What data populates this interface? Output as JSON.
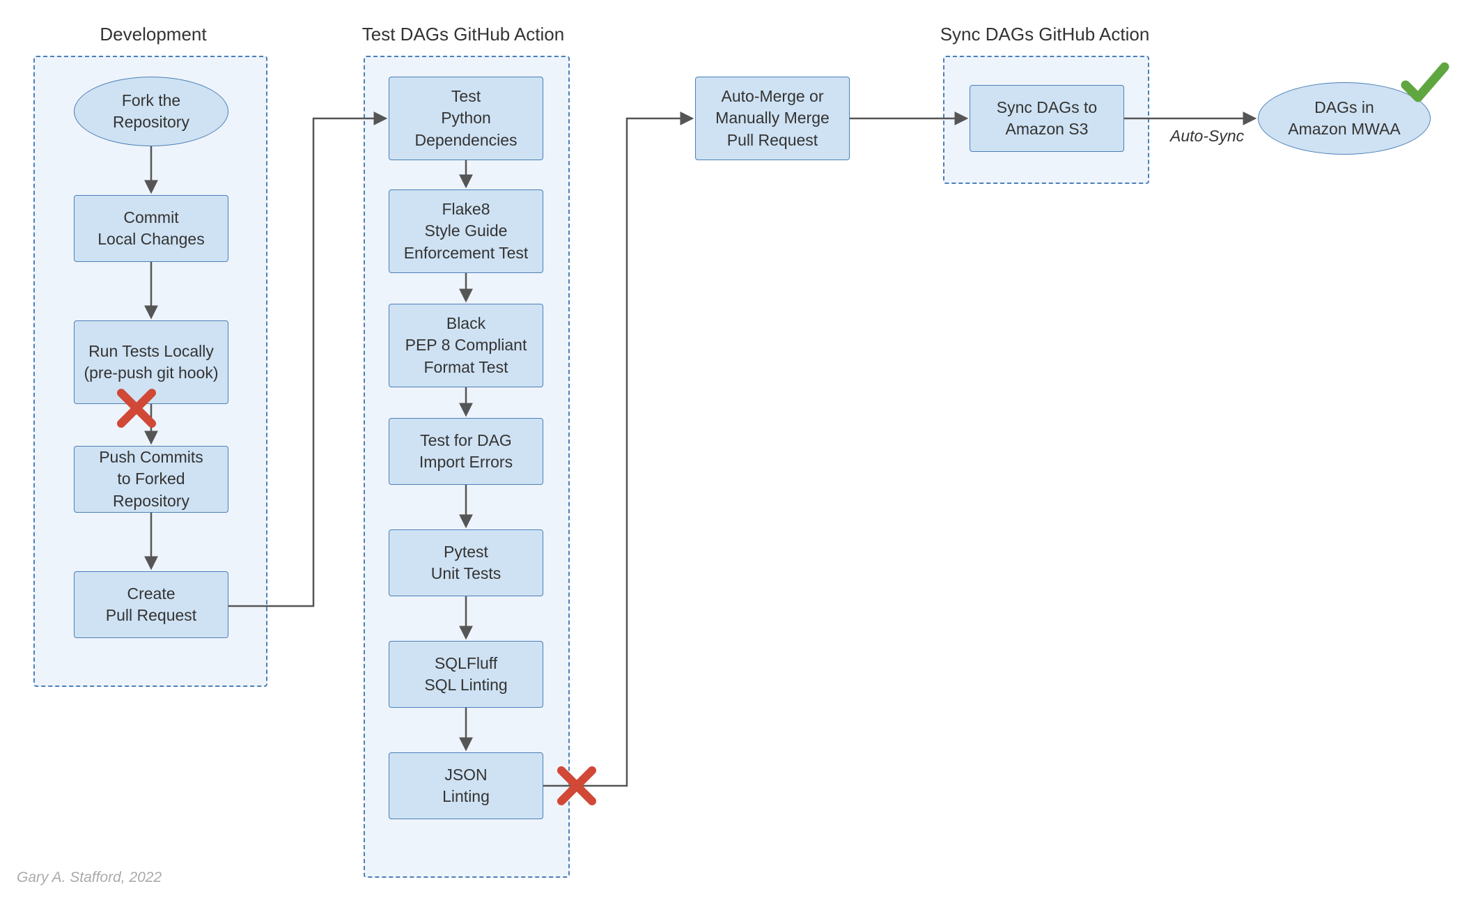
{
  "footer": "Gary A. Stafford, 2022",
  "edge_labels": {
    "autosync": "Auto-Sync"
  },
  "groups": {
    "dev": {
      "title": "Development"
    },
    "test": {
      "title": "Test DAGs GitHub Action"
    },
    "sync": {
      "title": "Sync DAGs GitHub Action"
    }
  },
  "nodes": {
    "fork": {
      "line1": "Fork the",
      "line2": "Repository"
    },
    "commit": {
      "line1": "Commit",
      "line2": "Local Changes"
    },
    "runlocal": {
      "line1": "Run Tests Locally",
      "line2": "(pre-push git hook)"
    },
    "push": {
      "line1": "Push Commits",
      "line2": "to Forked Repository"
    },
    "pr": {
      "line1": "Create",
      "line2": "Pull Request"
    },
    "pydep": {
      "line1": "Test",
      "line2": "Python",
      "line3": "Dependencies"
    },
    "flake8": {
      "line1": "Flake8",
      "line2": "Style Guide",
      "line3": "Enforcement Test"
    },
    "black": {
      "line1": "Black",
      "line2": "PEP 8 Compliant",
      "line3": "Format Test"
    },
    "dagimp": {
      "line1": "Test for DAG",
      "line2": "Import Errors"
    },
    "pytest": {
      "line1": "Pytest",
      "line2": "Unit Tests"
    },
    "sqlfluff": {
      "line1": "SQLFluff",
      "line2": "SQL Linting"
    },
    "jsonlint": {
      "line1": "JSON",
      "line2": "Linting"
    },
    "merge": {
      "line1": "Auto-Merge or",
      "line2": "Manually Merge",
      "line3": "Pull Request"
    },
    "syncS3": {
      "line1": "Sync DAGs to",
      "line2": "Amazon S3"
    },
    "mwaa": {
      "line1": "DAGs in",
      "line2": "Amazon MWAA"
    }
  },
  "icons": {
    "cross_color": "#d14836",
    "check_color": "#5fa641"
  }
}
